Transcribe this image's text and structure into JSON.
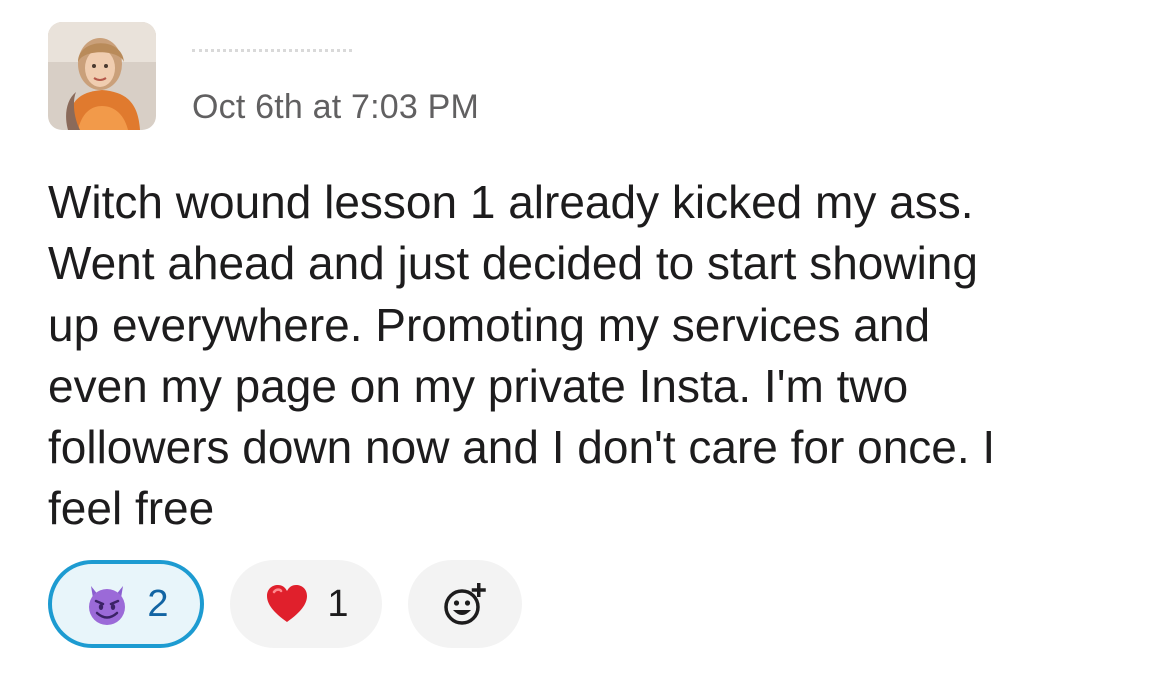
{
  "message": {
    "author": {
      "name": "",
      "avatar": "user-photo"
    },
    "timestamp": "Oct 6th at 7:03 PM",
    "lines": [
      "Witch wound lesson 1 already kicked my ass.",
      "Went ahead and just decided to start showing",
      "up everywhere. Promoting my services and",
      "even my page on my private Insta. I'm two",
      "followers down now and I don't care for once. I",
      "feel free"
    ]
  },
  "reactions": [
    {
      "emoji": "smiling-imp",
      "count": "2",
      "selected": true
    },
    {
      "emoji": "red-heart",
      "count": "1",
      "selected": false
    }
  ],
  "add_reaction": {
    "icon": "add-reaction-icon"
  },
  "colors": {
    "text": "#1d1c1d",
    "timestamp": "#616061",
    "selected_border": "#1d9bd1",
    "selected_bg": "#e8f5fa",
    "selected_count": "#1264a3",
    "pill_bg": "#f3f3f3"
  }
}
